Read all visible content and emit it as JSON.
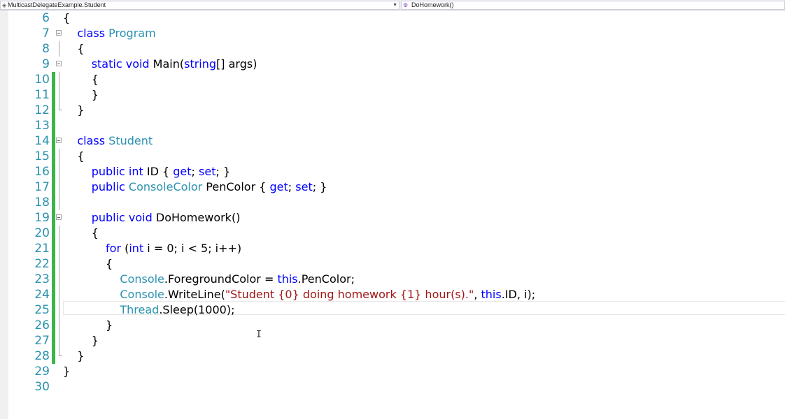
{
  "navbar": {
    "type_combo": "MulticastDelegateExample.Student",
    "member_combo": "DoHomework()",
    "type_icon": "class-icon",
    "member_icon": "method-icon"
  },
  "editor": {
    "changed_lines": [
      10,
      11,
      12,
      13,
      14,
      15,
      16,
      17,
      18,
      19,
      20,
      21,
      22,
      23,
      24,
      25,
      26,
      27,
      28
    ],
    "current_line": 25,
    "lines": [
      {
        "n": "6",
        "tokens": [
          [
            "p",
            "{"
          ]
        ]
      },
      {
        "n": "7",
        "tokens": [
          [
            "p",
            "    "
          ],
          [
            "kw",
            "class"
          ],
          [
            "p",
            " "
          ],
          [
            "ty",
            "Program"
          ]
        ]
      },
      {
        "n": "8",
        "tokens": [
          [
            "p",
            "    {"
          ]
        ]
      },
      {
        "n": "9",
        "tokens": [
          [
            "p",
            "        "
          ],
          [
            "kw",
            "static"
          ],
          [
            "p",
            " "
          ],
          [
            "kw",
            "void"
          ],
          [
            "p",
            " Main("
          ],
          [
            "kw",
            "string"
          ],
          [
            "p",
            "[] args)"
          ]
        ]
      },
      {
        "n": "10",
        "tokens": [
          [
            "p",
            "        {"
          ]
        ]
      },
      {
        "n": "11",
        "tokens": [
          [
            "p",
            "        }"
          ]
        ]
      },
      {
        "n": "12",
        "tokens": [
          [
            "p",
            "    }"
          ]
        ]
      },
      {
        "n": "13",
        "tokens": []
      },
      {
        "n": "14",
        "tokens": [
          [
            "p",
            "    "
          ],
          [
            "kw",
            "class"
          ],
          [
            "p",
            " "
          ],
          [
            "ty",
            "Student"
          ]
        ]
      },
      {
        "n": "15",
        "tokens": [
          [
            "p",
            "    {"
          ]
        ]
      },
      {
        "n": "16",
        "tokens": [
          [
            "p",
            "        "
          ],
          [
            "kw",
            "public"
          ],
          [
            "p",
            " "
          ],
          [
            "kw",
            "int"
          ],
          [
            "p",
            " ID { "
          ],
          [
            "kw",
            "get"
          ],
          [
            "p",
            "; "
          ],
          [
            "kw",
            "set"
          ],
          [
            "p",
            "; }"
          ]
        ]
      },
      {
        "n": "17",
        "tokens": [
          [
            "p",
            "        "
          ],
          [
            "kw",
            "public"
          ],
          [
            "p",
            " "
          ],
          [
            "ty",
            "ConsoleColor"
          ],
          [
            "p",
            " PenColor { "
          ],
          [
            "kw",
            "get"
          ],
          [
            "p",
            "; "
          ],
          [
            "kw",
            "set"
          ],
          [
            "p",
            "; }"
          ]
        ]
      },
      {
        "n": "18",
        "tokens": []
      },
      {
        "n": "19",
        "tokens": [
          [
            "p",
            "        "
          ],
          [
            "kw",
            "public"
          ],
          [
            "p",
            " "
          ],
          [
            "kw",
            "void"
          ],
          [
            "p",
            " DoHomework()"
          ]
        ]
      },
      {
        "n": "20",
        "tokens": [
          [
            "p",
            "        {"
          ]
        ]
      },
      {
        "n": "21",
        "tokens": [
          [
            "p",
            "            "
          ],
          [
            "kw",
            "for"
          ],
          [
            "p",
            " ("
          ],
          [
            "kw",
            "int"
          ],
          [
            "p",
            " i = 0; i < 5; i++)"
          ]
        ]
      },
      {
        "n": "22",
        "tokens": [
          [
            "p",
            "            {"
          ]
        ]
      },
      {
        "n": "23",
        "tokens": [
          [
            "p",
            "                "
          ],
          [
            "ty",
            "Console"
          ],
          [
            "p",
            ".ForegroundColor = "
          ],
          [
            "kw",
            "this"
          ],
          [
            "p",
            ".PenColor;"
          ]
        ]
      },
      {
        "n": "24",
        "tokens": [
          [
            "p",
            "                "
          ],
          [
            "ty",
            "Console"
          ],
          [
            "p",
            ".WriteLine("
          ],
          [
            "st",
            "\"Student {0} doing homework {1} hour(s).\""
          ],
          [
            "p",
            ", "
          ],
          [
            "kw",
            "this"
          ],
          [
            "p",
            ".ID, i);"
          ]
        ]
      },
      {
        "n": "25",
        "tokens": [
          [
            "p",
            "                "
          ],
          [
            "ty",
            "Thread"
          ],
          [
            "p",
            ".Sleep(1000);"
          ]
        ]
      },
      {
        "n": "26",
        "tokens": [
          [
            "p",
            "            }"
          ]
        ]
      },
      {
        "n": "27",
        "tokens": [
          [
            "p",
            "        }"
          ]
        ]
      },
      {
        "n": "28",
        "tokens": [
          [
            "p",
            "    }"
          ]
        ]
      },
      {
        "n": "29",
        "tokens": [
          [
            "p",
            "}"
          ]
        ]
      },
      {
        "n": "30",
        "tokens": []
      }
    ]
  },
  "colors": {
    "keyword": "#0000ff",
    "type": "#2b91af",
    "string": "#a31515",
    "line_number": "#2b91af",
    "changed_bar": "#3ab54a"
  }
}
